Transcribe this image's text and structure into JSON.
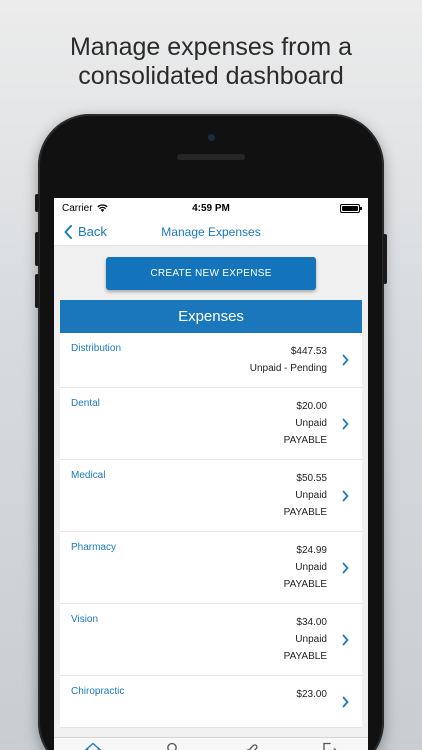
{
  "promo": {
    "line1": "Manage expenses from a",
    "line2": "consolidated dashboard"
  },
  "status": {
    "carrier": "Carrier",
    "time": "4:59 PM"
  },
  "nav": {
    "back_label": "Back",
    "title": "Manage Expenses"
  },
  "create_button": "CREATE NEW EXPENSE",
  "expenses": {
    "header": "Expenses",
    "items": [
      {
        "category": "Distribution",
        "lines": [
          "$447.53",
          "Unpaid - Pending"
        ]
      },
      {
        "category": "Dental",
        "lines": [
          "$20.00",
          "Unpaid",
          "PAYABLE"
        ]
      },
      {
        "category": "Medical",
        "lines": [
          "$50.55",
          "Unpaid",
          "PAYABLE"
        ]
      },
      {
        "category": "Pharmacy",
        "lines": [
          "$24.99",
          "Unpaid",
          "PAYABLE"
        ]
      },
      {
        "category": "Vision",
        "lines": [
          "$34.00",
          "Unpaid",
          "PAYABLE"
        ]
      },
      {
        "category": "Chiropractic",
        "lines": [
          "$23.00"
        ]
      }
    ]
  },
  "tabs": [
    {
      "label": "Home",
      "icon": "home-icon",
      "active": true
    },
    {
      "label": "Profile",
      "icon": "profile-icon",
      "active": false
    },
    {
      "label": "External Link",
      "icon": "link-icon",
      "active": false
    },
    {
      "label": "Log Out",
      "icon": "logout-icon",
      "active": false
    }
  ],
  "colors": {
    "accent": "#1a7abf",
    "header": "#1b77bb",
    "button": "#1474bb"
  }
}
